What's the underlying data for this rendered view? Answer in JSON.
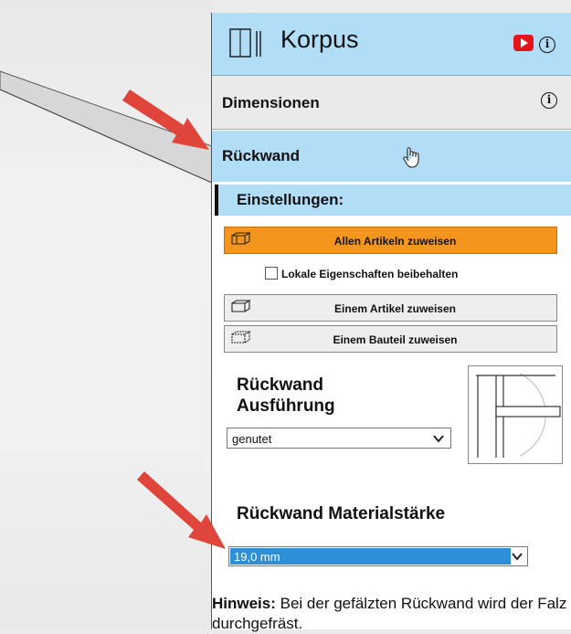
{
  "header": {
    "title": "Korpus"
  },
  "sections": {
    "dimensionen": "Dimensionen",
    "rueckwand": "Rückwand"
  },
  "settings": {
    "title": "Einstellungen:",
    "assign_all": "Allen Artikeln zuweisen",
    "keep_local": "Lokale Eigenschaften beibehalten",
    "assign_article": "Einem Artikel zuweisen",
    "assign_part": "Einem Bauteil zuweisen"
  },
  "ausfuehrung": {
    "label_line1": "Rückwand",
    "label_line2": "Ausführung",
    "selected": "genutet"
  },
  "materialstaerke": {
    "label": "Rückwand Materialstärke",
    "selected": "19,0 mm"
  },
  "hint": {
    "label": "Hinweis:",
    "text": " Bei der gefälzten Rückwand wird der Falz durchgefräst."
  },
  "icons": {
    "header": "cabinet-icon",
    "youtube": "youtube-icon",
    "info": "info-icon",
    "cursor": "hand-pointer-icon"
  },
  "colors": {
    "panel_blue": "#b2ddf6",
    "accent_orange": "#f4951e",
    "select_blue": "#2d8fd5",
    "arrow_red": "#e0453c"
  }
}
